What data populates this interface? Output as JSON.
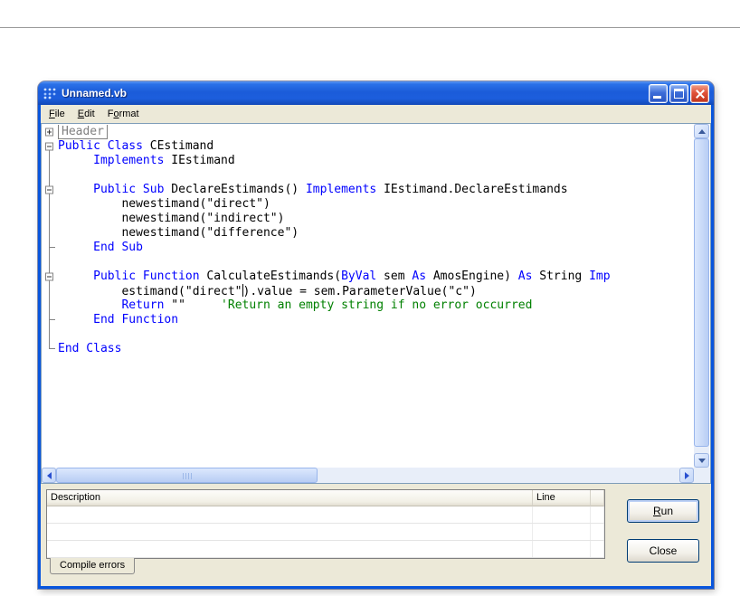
{
  "window": {
    "title": "Unnamed.vb"
  },
  "menu": {
    "items": [
      {
        "pre": "",
        "u": "F",
        "rest": "ile"
      },
      {
        "pre": "",
        "u": "E",
        "rest": "dit"
      },
      {
        "pre": "F",
        "u": "o",
        "rest": "rmat"
      }
    ]
  },
  "editor": {
    "lines": [
      {
        "fold": "plus",
        "segs": [
          {
            "t": "Header",
            "c": "hdr"
          }
        ]
      },
      {
        "fold": "minus-start",
        "segs": [
          {
            "t": "Public Class",
            "c": "k"
          },
          {
            "t": " CEstimand",
            "c": "p"
          }
        ]
      },
      {
        "fold": "line",
        "segs": [
          {
            "t": "     ",
            "c": "p"
          },
          {
            "t": "Implements",
            "c": "k"
          },
          {
            "t": " IEstimand",
            "c": "p"
          }
        ]
      },
      {
        "fold": "line",
        "segs": []
      },
      {
        "fold": "minus",
        "segs": [
          {
            "t": "     ",
            "c": "p"
          },
          {
            "t": "Public Sub",
            "c": "k"
          },
          {
            "t": " DeclareEstimands() ",
            "c": "p"
          },
          {
            "t": "Implements",
            "c": "k"
          },
          {
            "t": " IEstimand.DeclareEstimands",
            "c": "p"
          }
        ]
      },
      {
        "fold": "line",
        "segs": [
          {
            "t": "         newestimand(\"direct\")",
            "c": "p"
          }
        ]
      },
      {
        "fold": "line",
        "segs": [
          {
            "t": "         newestimand(\"indirect\")",
            "c": "p"
          }
        ]
      },
      {
        "fold": "line",
        "segs": [
          {
            "t": "         newestimand(\"difference\")",
            "c": "p"
          }
        ]
      },
      {
        "fold": "tick",
        "segs": [
          {
            "t": "     ",
            "c": "p"
          },
          {
            "t": "End Sub",
            "c": "k"
          }
        ]
      },
      {
        "fold": "line",
        "segs": []
      },
      {
        "fold": "minus",
        "segs": [
          {
            "t": "     ",
            "c": "p"
          },
          {
            "t": "Public Function",
            "c": "k"
          },
          {
            "t": " CalculateEstimands(",
            "c": "p"
          },
          {
            "t": "ByVal",
            "c": "k"
          },
          {
            "t": " sem ",
            "c": "p"
          },
          {
            "t": "As",
            "c": "k"
          },
          {
            "t": " AmosEngine) ",
            "c": "p"
          },
          {
            "t": "As",
            "c": "k"
          },
          {
            "t": " String ",
            "c": "p"
          },
          {
            "t": "Imp",
            "c": "k"
          }
        ]
      },
      {
        "fold": "line",
        "segs": [
          {
            "t": "         estimand(\"direct\"",
            "c": "p"
          },
          {
            "t": "",
            "c": "caret"
          },
          {
            "t": ").value = sem.ParameterValue(\"c\")",
            "c": "p"
          }
        ]
      },
      {
        "fold": "line",
        "segs": [
          {
            "t": "         ",
            "c": "p"
          },
          {
            "t": "Return",
            "c": "k"
          },
          {
            "t": " \"\"     ",
            "c": "p"
          },
          {
            "t": "'Return an empty string if no error occurred",
            "c": "c"
          }
        ]
      },
      {
        "fold": "tick",
        "segs": [
          {
            "t": "     ",
            "c": "p"
          },
          {
            "t": "End Function",
            "c": "k"
          }
        ]
      },
      {
        "fold": "line",
        "segs": []
      },
      {
        "fold": "end",
        "segs": [
          {
            "t": "End Class",
            "c": "k"
          }
        ]
      }
    ]
  },
  "colors": {
    "keyword": "#0000FF",
    "comment": "#008000",
    "collapsed": "#808080",
    "titlebar": "#0855DD"
  },
  "errors_panel": {
    "columns": [
      {
        "label": "Description"
      },
      {
        "label": "Line"
      },
      {
        "label": ""
      }
    ],
    "rows": [],
    "empty_row_count": 3,
    "tab_label": "Compile errors"
  },
  "actions": {
    "run": {
      "u": "R",
      "rest": "un"
    },
    "close": {
      "label": "Close"
    }
  }
}
